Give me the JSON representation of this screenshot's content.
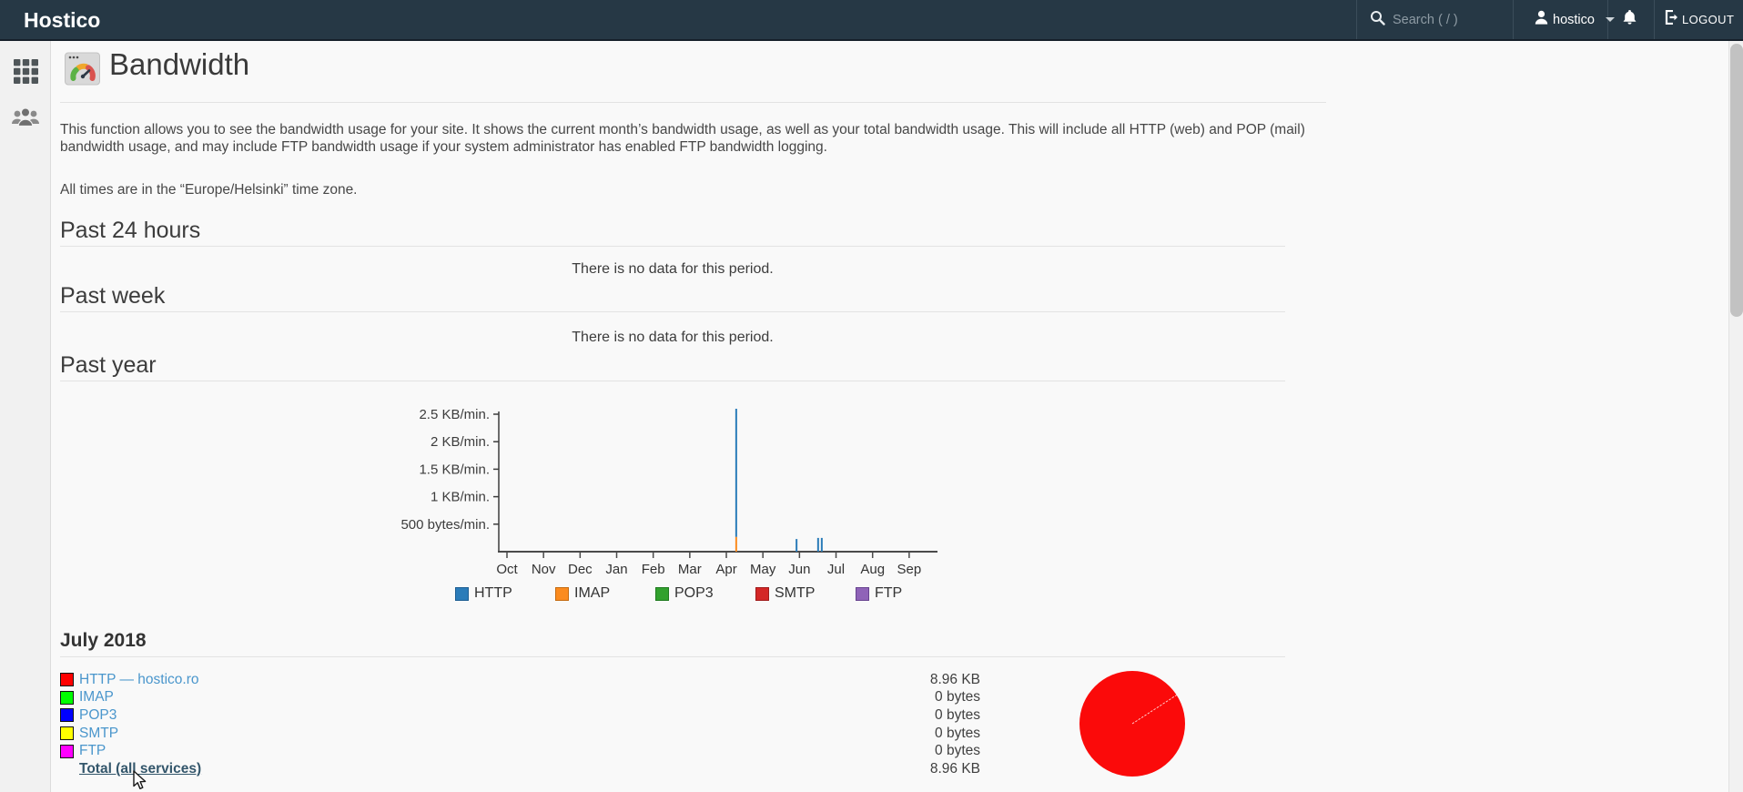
{
  "colors": {
    "header_bg": "#263845",
    "link": "#4a96cc",
    "total_link": "#33566b",
    "rule": "#e3e3e3",
    "axis": "#3c3c3c"
  },
  "header": {
    "brand": "Hostico",
    "search_placeholder": "Search ( / )",
    "username": "hostico",
    "logout_label": "LOGOUT"
  },
  "sidebar": {
    "items": [
      {
        "icon": "grid-icon"
      },
      {
        "icon": "users-icon"
      }
    ]
  },
  "page": {
    "title": "Bandwidth",
    "description": "This function allows you to see the bandwidth usage for your site. It shows the current month’s bandwidth usage, as well as your total bandwidth usage. This will include all HTTP (web) and POP (mail) bandwidth usage, and may include FTP bandwidth usage if your system administrator has enabled FTP bandwidth logging.",
    "timezone_note": "All times are in the “Europe/Helsinki” time zone.",
    "sections": {
      "past24": {
        "heading": "Past 24 hours",
        "empty": "There is no data for this period."
      },
      "pastweek": {
        "heading": "Past week",
        "empty": "There is no data for this period."
      },
      "pastyear": {
        "heading": "Past year"
      }
    },
    "month_heading": "July 2018"
  },
  "chart_data": {
    "type": "bar",
    "title": "Past year bandwidth (KB/min.)",
    "categories": [
      "Oct",
      "Nov",
      "Dec",
      "Jan",
      "Feb",
      "Mar",
      "Apr",
      "May",
      "Jun",
      "Jul",
      "Aug",
      "Sep"
    ],
    "ylabel": "KB/min.",
    "ylim": [
      0,
      2.5
    ],
    "grid": false,
    "legend_position": "bottom",
    "yticks": [
      {
        "label": "2.5 KB/min.",
        "value": 2.5
      },
      {
        "label": "2 KB/min.",
        "value": 2.0
      },
      {
        "label": "1.5 KB/min.",
        "value": 1.5
      },
      {
        "label": "1 KB/min.",
        "value": 1.0
      },
      {
        "label": "500 bytes/min.",
        "value": 0.5
      }
    ],
    "series": [
      {
        "name": "HTTP",
        "color": "#2b7cb9",
        "border": "#1d5e92"
      },
      {
        "name": "IMAP",
        "color": "#fb8b1e",
        "border": "#c56a10"
      },
      {
        "name": "POP3",
        "color": "#32a12e",
        "border": "#1f7a1f"
      },
      {
        "name": "SMTP",
        "color": "#d42726",
        "border": "#9f1b1b"
      },
      {
        "name": "FTP",
        "color": "#8f63b8",
        "border": "#67438f"
      }
    ],
    "spikes": [
      {
        "month_frac": 6.27,
        "approx_time": "mid April",
        "segments": [
          {
            "service": "IMAP",
            "value": 0.27
          },
          {
            "service": "HTTP",
            "value": 2.33
          }
        ]
      },
      {
        "month_frac": 7.92,
        "approx_time": "early June",
        "segments": [
          {
            "service": "HTTP",
            "value": 0.23
          }
        ]
      },
      {
        "month_frac": 8.51,
        "approx_time": "late June",
        "segments": [
          {
            "service": "HTTP",
            "value": 0.25
          }
        ]
      },
      {
        "month_frac": 8.61,
        "approx_time": "late June",
        "segments": [
          {
            "service": "HTTP",
            "value": 0.25
          }
        ]
      }
    ]
  },
  "usage_table": {
    "rows": [
      {
        "service": "HTTP — hostico.ro",
        "swatch": "#ff0000",
        "value": "8.96 KB"
      },
      {
        "service": "IMAP",
        "swatch": "#00ff00",
        "value": "0 bytes"
      },
      {
        "service": "POP3",
        "swatch": "#0000ff",
        "value": "0 bytes"
      },
      {
        "service": "SMTP",
        "swatch": "#ffff00",
        "value": "0 bytes"
      },
      {
        "service": "FTP",
        "swatch": "#ff00ff",
        "value": "0 bytes"
      },
      {
        "service": "Total (all services)",
        "swatch": null,
        "value": "8.96 KB",
        "total": true
      }
    ]
  },
  "pie": {
    "color": "#fb0a0a",
    "slices": [
      {
        "label": "HTTP",
        "percent": 100
      }
    ]
  }
}
